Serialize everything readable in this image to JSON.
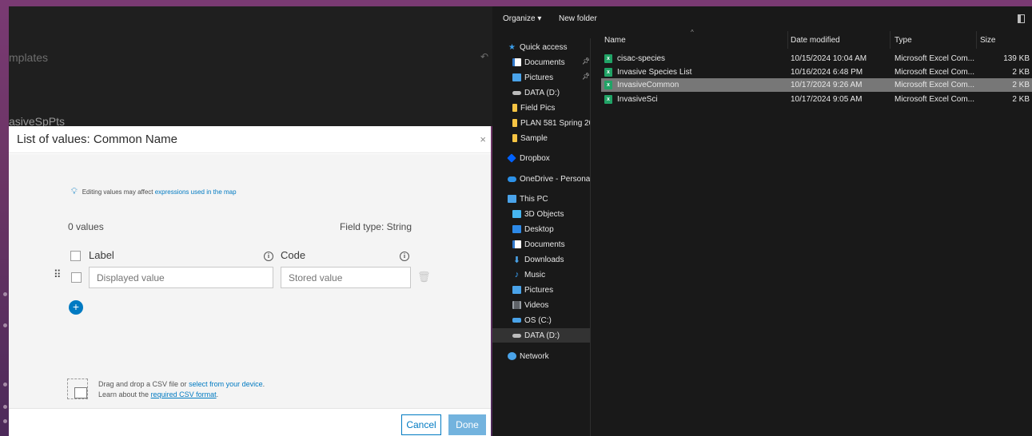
{
  "background_app": {
    "templates_text": "mplates",
    "layer_text": "asiveSpPts"
  },
  "dialog": {
    "title": "List of values: Common Name",
    "close_label": "×",
    "hint_text": "Editing values may affect ",
    "hint_link": "expressions used in the map",
    "value_count": "0 values",
    "field_type": "Field type: String",
    "label_header": "Label",
    "code_header": "Code",
    "label_placeholder": "Displayed value",
    "code_placeholder": "Stored value",
    "add_label": "+",
    "csv_line1_prefix": "Drag and drop a CSV file or ",
    "csv_line1_link": "select from your device",
    "csv_line1_suffix": ".",
    "csv_line2_prefix": "Learn about the ",
    "csv_line2_link": "required CSV format",
    "csv_line2_suffix": ".",
    "cancel_label": "Cancel",
    "done_label": "Done",
    "accent_color": "#007ac2"
  },
  "explorer": {
    "organize_label": "Organize ▾",
    "new_folder_label": "New folder",
    "nav": [
      {
        "label": "Quick access",
        "icon": "star-icon",
        "pinned": false
      },
      {
        "label": "Documents",
        "icon": "documents-icon",
        "pinned": true
      },
      {
        "label": "Pictures",
        "icon": "pictures-icon",
        "pinned": true
      },
      {
        "label": "DATA (D:)",
        "icon": "drive-icon",
        "pinned": false
      },
      {
        "label": "Field Pics",
        "icon": "folder-icon",
        "pinned": false
      },
      {
        "label": "PLAN 581 Spring 20",
        "icon": "folder-icon",
        "pinned": false
      },
      {
        "label": "Sample",
        "icon": "folder-icon",
        "pinned": false
      },
      {
        "label": "Dropbox",
        "icon": "dropbox-icon",
        "pinned": false
      },
      {
        "label": "OneDrive - Personal",
        "icon": "onedrive-icon",
        "pinned": false
      },
      {
        "label": "This PC",
        "icon": "pc-icon",
        "pinned": false
      },
      {
        "label": "3D Objects",
        "icon": "3d-objects-icon",
        "pinned": false
      },
      {
        "label": "Desktop",
        "icon": "desktop-icon",
        "pinned": false
      },
      {
        "label": "Documents",
        "icon": "documents-icon",
        "pinned": false
      },
      {
        "label": "Downloads",
        "icon": "downloads-icon",
        "pinned": false
      },
      {
        "label": "Music",
        "icon": "music-icon",
        "pinned": false
      },
      {
        "label": "Pictures",
        "icon": "pictures-icon",
        "pinned": false
      },
      {
        "label": "Videos",
        "icon": "videos-icon",
        "pinned": false
      },
      {
        "label": "OS (C:)",
        "icon": "os-drive-icon",
        "pinned": false
      },
      {
        "label": "DATA (D:)",
        "icon": "drive-icon",
        "pinned": false,
        "selected": true
      },
      {
        "label": "Network",
        "icon": "network-icon",
        "pinned": false
      }
    ],
    "columns": {
      "name": "Name",
      "date": "Date modified",
      "type": "Type",
      "size": "Size"
    },
    "files": [
      {
        "name": "cisac-species",
        "date": "10/15/2024 10:04 AM",
        "type": "Microsoft Excel Com...",
        "size": "139 KB",
        "selected": false
      },
      {
        "name": "Invasive Species List",
        "date": "10/16/2024 6:48 PM",
        "type": "Microsoft Excel Com...",
        "size": "2 KB",
        "selected": false
      },
      {
        "name": "InvasiveCommon",
        "date": "10/17/2024 9:26 AM",
        "type": "Microsoft Excel Com...",
        "size": "2 KB",
        "selected": true
      },
      {
        "name": "InvasiveSci",
        "date": "10/17/2024 9:05 AM",
        "type": "Microsoft Excel Com...",
        "size": "2 KB",
        "selected": false
      }
    ]
  }
}
